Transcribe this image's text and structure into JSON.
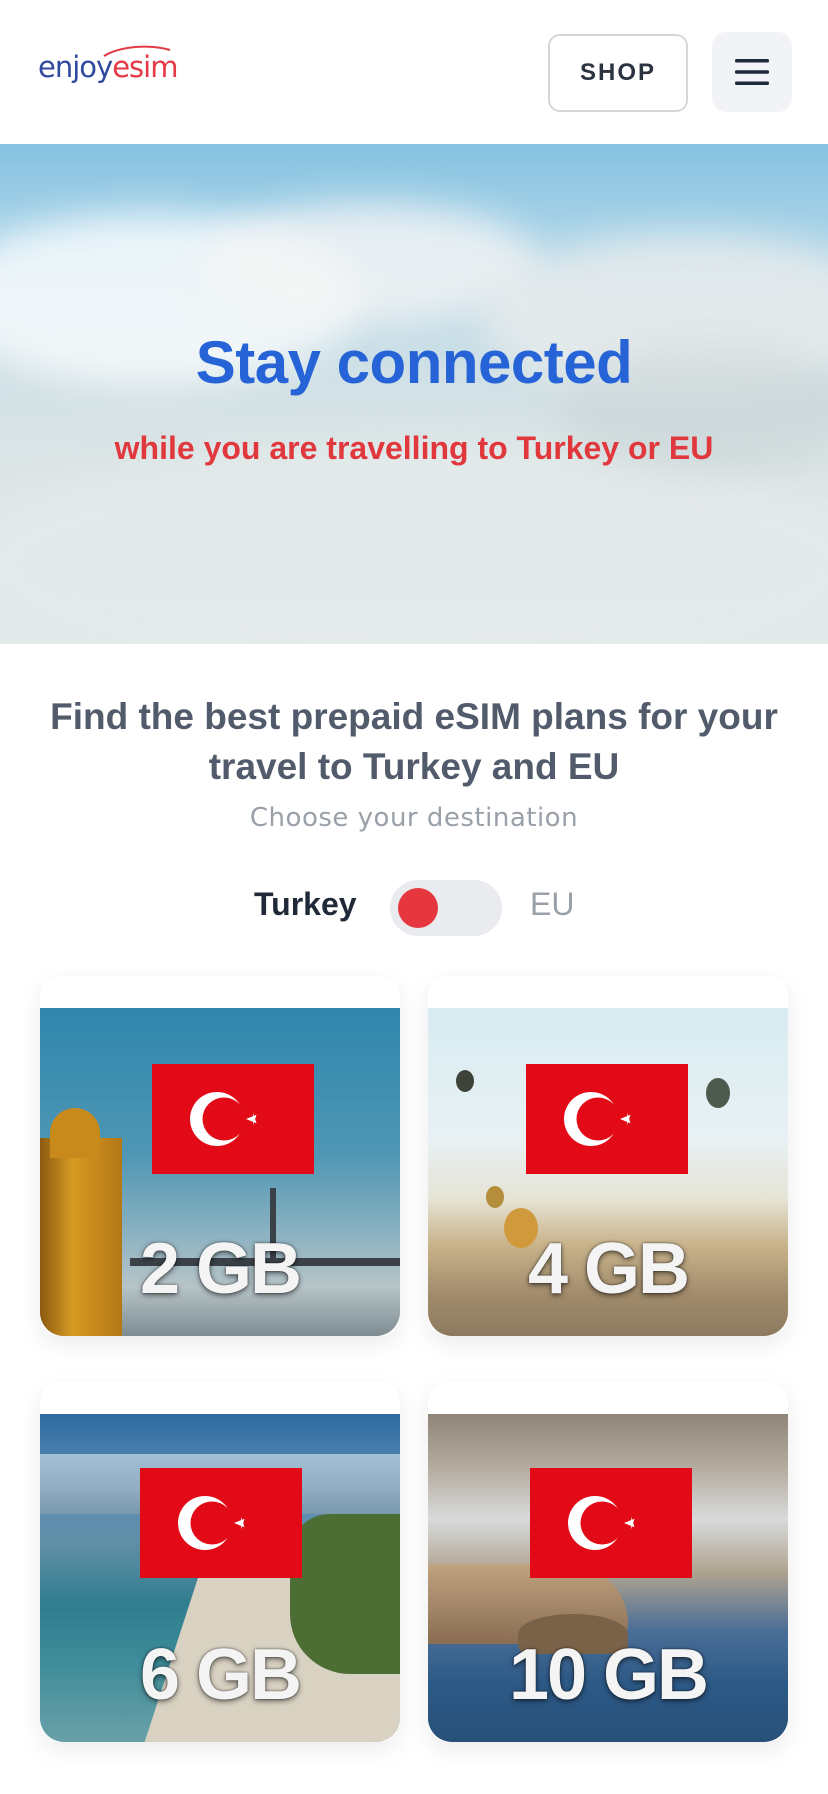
{
  "header": {
    "logo_enjoy": "enjoy",
    "logo_esim": "esim",
    "shop_label": "SHOP",
    "menu_icon": "hamburger-menu-icon"
  },
  "hero": {
    "title": "Stay connected",
    "subtitle": "while you are travelling to Turkey or EU"
  },
  "intro": {
    "title": "Find the best prepaid eSIM plans for your travel to Turkey and EU",
    "subtitle": "Choose your destination"
  },
  "destination_toggle": {
    "left_label": "Turkey",
    "right_label": "EU",
    "selected": "Turkey"
  },
  "plans": [
    {
      "data": "2 GB",
      "flag": "turkey-flag-icon"
    },
    {
      "data": "4 GB",
      "flag": "turkey-flag-icon"
    },
    {
      "data": "6 GB",
      "flag": "turkey-flag-icon"
    },
    {
      "data": "10 GB",
      "flag": "turkey-flag-icon"
    }
  ],
  "colors": {
    "brand_blue": "#2563d6",
    "brand_red": "#e0383c",
    "flag_red": "#e30a17"
  }
}
